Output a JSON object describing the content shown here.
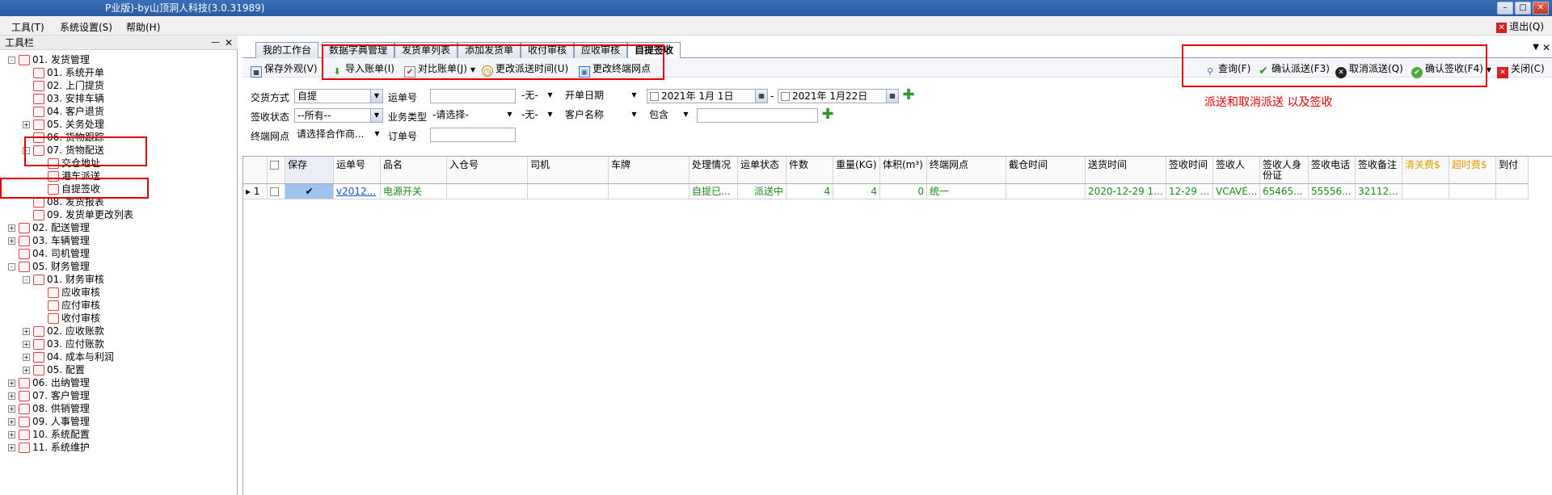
{
  "window": {
    "title": "P业版)-by山顶洞人科技(3.0.31989)"
  },
  "menu": {
    "items": [
      "工具(T)",
      "系统设置(S)",
      "帮助(H)"
    ],
    "exit": "退出(Q)"
  },
  "sidebar": {
    "title": "工具栏",
    "nodes": [
      {
        "label": "01. 发货管理",
        "level": 0,
        "exp": "-"
      },
      {
        "label": "01. 系统开单",
        "level": 1
      },
      {
        "label": "02. 上门提货",
        "level": 1
      },
      {
        "label": "03. 安排车辆",
        "level": 1
      },
      {
        "label": "04. 客户退货",
        "level": 1
      },
      {
        "label": "05. 关务处理",
        "level": 1,
        "exp": "+"
      },
      {
        "label": "06. 货物跟踪",
        "level": 1
      },
      {
        "label": "07. 货物配送",
        "level": 1,
        "exp": "-"
      },
      {
        "label": "交仓地址",
        "level": 2
      },
      {
        "label": "港车派送",
        "level": 2
      },
      {
        "label": "自提签收",
        "level": 2
      },
      {
        "label": "08. 发货报表",
        "level": 1
      },
      {
        "label": "09. 发货单更改列表",
        "level": 1
      },
      {
        "label": "02. 配送管理",
        "level": 0,
        "exp": "+"
      },
      {
        "label": "03. 车辆管理",
        "level": 0,
        "exp": "+"
      },
      {
        "label": "04. 司机管理",
        "level": 0
      },
      {
        "label": "05. 财务管理",
        "level": 0,
        "exp": "-"
      },
      {
        "label": "01. 财务审核",
        "level": 1,
        "exp": "-"
      },
      {
        "label": "应收审核",
        "level": 2
      },
      {
        "label": "应付审核",
        "level": 2
      },
      {
        "label": "收付审核",
        "level": 2
      },
      {
        "label": "02. 应收账款",
        "level": 1,
        "exp": "+"
      },
      {
        "label": "03. 应付账款",
        "level": 1,
        "exp": "+"
      },
      {
        "label": "04. 成本与利润",
        "level": 1,
        "exp": "+"
      },
      {
        "label": "05. 配置",
        "level": 1,
        "exp": "+"
      },
      {
        "label": "06. 出纳管理",
        "level": 0,
        "exp": "+"
      },
      {
        "label": "07. 客户管理",
        "level": 0,
        "exp": "+"
      },
      {
        "label": "08. 供销管理",
        "level": 0,
        "exp": "+"
      },
      {
        "label": "09. 人事管理",
        "level": 0,
        "exp": "+"
      },
      {
        "label": "10. 系统配置",
        "level": 0,
        "exp": "+"
      },
      {
        "label": "11. 系统维护",
        "level": 0,
        "exp": "+"
      }
    ]
  },
  "tabs": [
    "我的工作台",
    "数据字典管理",
    "发货单列表",
    "添加发货单",
    "收付审核",
    "应收审核",
    "自提签收"
  ],
  "toolbar": {
    "save_layout": "保存外观(V)",
    "import": "导入账单(I)",
    "compare": "对比账单(J)",
    "change_time": "更改派送时间(U)",
    "change_site": "更改终端网点",
    "query": "查询(F)",
    "confirm_dispatch": "确认派送(F3)",
    "cancel_dispatch": "取消派送(Q)",
    "confirm_sign": "确认签收(F4)",
    "close": "关闭(C)"
  },
  "filters": {
    "delivery_mode_label": "交货方式",
    "delivery_mode_value": "自提",
    "waybill_label": "运单号",
    "none1": "-无-",
    "date_type": "开单日期",
    "date_from": "2021年 1月 1日",
    "date_to": "2021年 1月22日",
    "sign_status_label": "签收状态",
    "sign_status_value": "--所有--",
    "business_type_label": "业务类型",
    "business_type_value": "-请选择-",
    "none2": "-无-",
    "customer_label": "客户名称",
    "contains": "包含",
    "terminal_label": "终端网点",
    "terminal_value": "请选择合作商...",
    "order_label": "订单号"
  },
  "annotation": "派送和取消派送 以及签收",
  "grid": {
    "headers": [
      "",
      "",
      "保存",
      "运单号",
      "品名",
      "入仓号",
      "司机",
      "车牌",
      "处理情况",
      "运单状态",
      "件数",
      "重量(KG)",
      "体积(m³)",
      "终端网点",
      "截仓时间",
      "送货时间",
      "签收时间",
      "签收人",
      "签收人身份证",
      "签收电话",
      "签收备注",
      "清关费$",
      "超时费$",
      "到付"
    ],
    "rows": [
      [
        "▸ 1",
        "",
        "✔",
        "v2012...",
        "电源开关",
        "",
        "",
        "",
        "自提已...",
        "派送中",
        "4",
        "4",
        "0",
        "统一",
        "",
        "2020-12-29 1...",
        "12-29 ...",
        "VCAVE...",
        "65465...",
        "55556...",
        "32112...",
        "",
        "",
        ""
      ]
    ]
  },
  "colors": {
    "highlight": "#e00000",
    "row_text": "#1b8a1b",
    "title_bar": "#2a5aa0",
    "orange_header": "#e69a00"
  }
}
